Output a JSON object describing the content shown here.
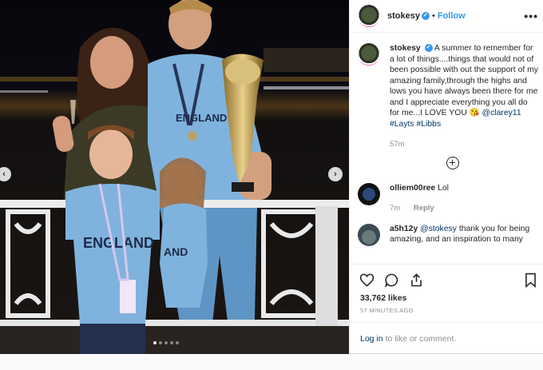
{
  "post": {
    "username": "stokesy",
    "verified_label": "✔",
    "separator": "•",
    "follow_label": "Follow",
    "more_label": "•••"
  },
  "caption": {
    "username": "stokesy",
    "text": "A summer to remember for a lot of things....things that would not of been possible with out the support of my amazing family,through the highs and lows you have always been there for me and I appreciate everything you all do for me...I LOVE YOU 😘",
    "mention": "@clarey11",
    "hashtag1": "#Layts",
    "hashtag2": "#Libbs",
    "time": "57m"
  },
  "comments": [
    {
      "username": "olliem00ree",
      "text": "Lol",
      "time": "7m",
      "reply_label": "Reply"
    },
    {
      "username": "a5h12y",
      "mention": "@stokesy",
      "text": "thank you for being amazing, and an inspiration to many"
    }
  ],
  "stats": {
    "likes": "33,762 likes",
    "time_ago": "57 MINUTES AGO"
  },
  "login_bar": {
    "link": "Log in",
    "text": "to like or comment."
  },
  "carousel": {
    "count": 5,
    "active_index": 0
  },
  "icons": {
    "prev": "chevron-left-icon",
    "next": "chevron-right-icon",
    "like": "heart-icon",
    "comment": "comment-icon",
    "share": "share-icon",
    "save": "bookmark-icon",
    "load_more": "plus-circle-icon"
  },
  "colors": {
    "accent": "#3897f0",
    "link": "#003569",
    "muted": "#8e8e8e",
    "jersey": "#7fb3dd"
  }
}
